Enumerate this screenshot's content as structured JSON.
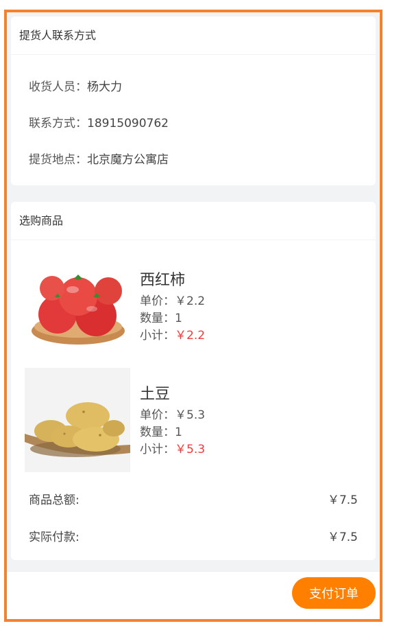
{
  "contact": {
    "title": "提货人联系方式",
    "receiver_label": "收货人员：",
    "receiver": "杨大力",
    "phone_label": "联系方式：",
    "phone": "18915090762",
    "address_label": "提货地点：",
    "address": "北京魔方公寓店"
  },
  "goods": {
    "title": "选购商品",
    "items": [
      {
        "name": "西红柿",
        "price_label": "单价：",
        "price": "￥2.2",
        "qty_label": "数量：",
        "qty": "1",
        "subtotal_label": "小计：",
        "subtotal": "￥2.2",
        "image": "tomato-image"
      },
      {
        "name": "土豆",
        "price_label": "单价：",
        "price": "￥5.3",
        "qty_label": "数量：",
        "qty": "1",
        "subtotal_label": "小计：",
        "subtotal": "￥5.3",
        "image": "potato-image"
      }
    ],
    "total_label": "商品总额:",
    "total": "￥7.5",
    "paid_label": "实际付款:",
    "paid": "￥7.5"
  },
  "footer": {
    "pay_label": "支付订单"
  },
  "colors": {
    "accent": "#ff7f00",
    "frame": "#f5822a",
    "price_red": "#f23c3c"
  }
}
